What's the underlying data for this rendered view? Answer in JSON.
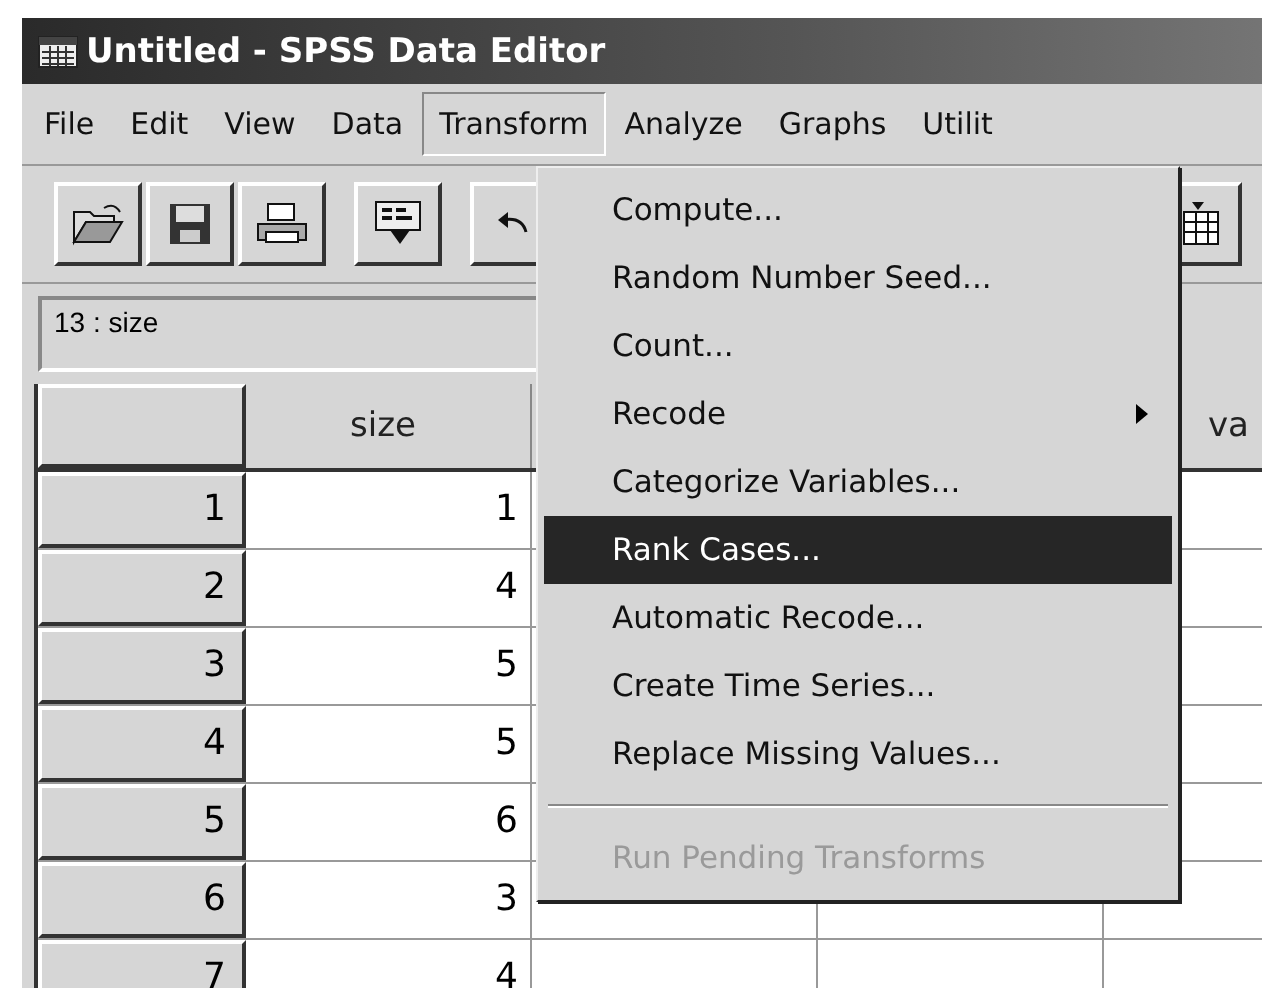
{
  "window": {
    "title": "Untitled - SPSS Data Editor"
  },
  "menu_bar": [
    {
      "label": "File",
      "selected": false
    },
    {
      "label": "Edit",
      "selected": false
    },
    {
      "label": "View",
      "selected": false
    },
    {
      "label": "Data",
      "selected": false
    },
    {
      "label": "Transform",
      "selected": true
    },
    {
      "label": "Analyze",
      "selected": false
    },
    {
      "label": "Graphs",
      "selected": false
    },
    {
      "label": "Utilit",
      "selected": false
    }
  ],
  "cell_reference": "13 : size",
  "columns": [
    {
      "label": "size"
    },
    {},
    {},
    {
      "label": "va"
    }
  ],
  "rows": [
    {
      "number": "1",
      "size": "1"
    },
    {
      "number": "2",
      "size": "4"
    },
    {
      "number": "3",
      "size": "5"
    },
    {
      "number": "4",
      "size": "5"
    },
    {
      "number": "5",
      "size": "6"
    },
    {
      "number": "6",
      "size": "3"
    },
    {
      "number": "7",
      "size": "4"
    }
  ],
  "dropdown": [
    {
      "kind": "item",
      "label": "Compute...",
      "selected": false,
      "disabled": false
    },
    {
      "kind": "item",
      "label": "Random Number Seed...",
      "selected": false,
      "disabled": false
    },
    {
      "kind": "item",
      "label": "Count...",
      "selected": false,
      "disabled": false
    },
    {
      "kind": "submenu",
      "label": "Recode",
      "selected": false,
      "disabled": false
    },
    {
      "kind": "item",
      "label": "Categorize Variables...",
      "selected": false,
      "disabled": false
    },
    {
      "kind": "item",
      "label": "Rank Cases...",
      "selected": true,
      "disabled": false
    },
    {
      "kind": "item",
      "label": "Automatic Recode...",
      "selected": false,
      "disabled": false
    },
    {
      "kind": "item",
      "label": "Create Time Series...",
      "selected": false,
      "disabled": false
    },
    {
      "kind": "item",
      "label": "Replace Missing Values...",
      "selected": false,
      "disabled": false
    },
    {
      "kind": "separator"
    },
    {
      "kind": "item",
      "label": "Run Pending Transforms",
      "selected": false,
      "disabled": true
    }
  ]
}
